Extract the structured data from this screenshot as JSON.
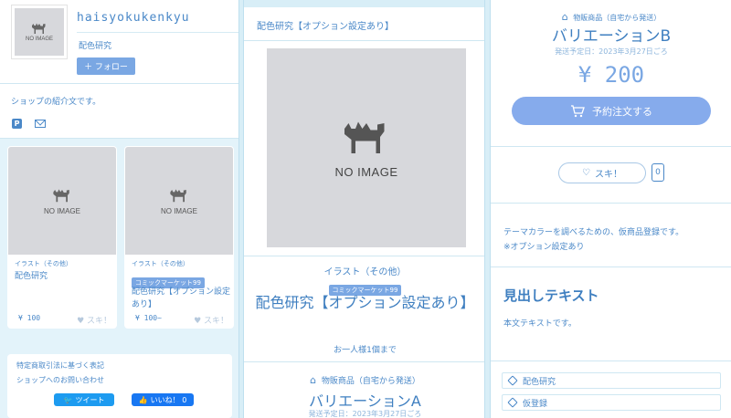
{
  "shop": {
    "name": "haisyokukenkyu",
    "subtitle": "配色研究",
    "follow_label": "＋ フォロー",
    "intro": "ショップの紹介文です。",
    "noimage_label": "NO IMAGE"
  },
  "cards": [
    {
      "category": "イラスト（その他）",
      "tag": "",
      "title": "配色研究",
      "price": "¥ 100",
      "like": "♥ スキ！"
    },
    {
      "category": "イラスト（その他）",
      "tag": "コミックマーケット99",
      "title": "配色研究【オプション設定あり】",
      "price": "¥ 100~",
      "like": "♥ スキ！"
    }
  ],
  "footer": {
    "law": "特定商取引法に基づく表記",
    "contact": "ショップへのお問い合わせ",
    "tweet": "ツイート",
    "fb_like": "いいね！ 0"
  },
  "detail": {
    "header_title": "配色研究【オプション設定あり】",
    "category": "イラスト（その他）",
    "tag": "コミックマーケット99",
    "name": "配色研究【オプション設定あり】",
    "limit": "お一人様1個まで",
    "variant_a": {
      "shipping": "物販商品（自宅から発送）",
      "name": "バリエーションA",
      "date": "発送予定日：2023年3月27日ごろ"
    },
    "variant_b": {
      "shipping": "物販商品（自宅から発送）",
      "name": "バリエーションB",
      "date": "発送予定日：2023年3月27日ごろ",
      "price": "¥ 200",
      "order_label": "予約注文する"
    },
    "like_label": "スキ！",
    "like_count": "0",
    "description_1": "テーマカラーを調べるための、仮商品登録です。",
    "description_2": "※オプション設定あり",
    "heading": "見出しテキスト",
    "body": "本文テキストです。",
    "tags": [
      "配色研究",
      "仮登録"
    ]
  },
  "colors": {
    "accent": "#4a88c8",
    "button": "#7aa7e3",
    "order_button": "#86abec",
    "background": "#d8eef7",
    "placeholder": "#d7d8dc"
  }
}
